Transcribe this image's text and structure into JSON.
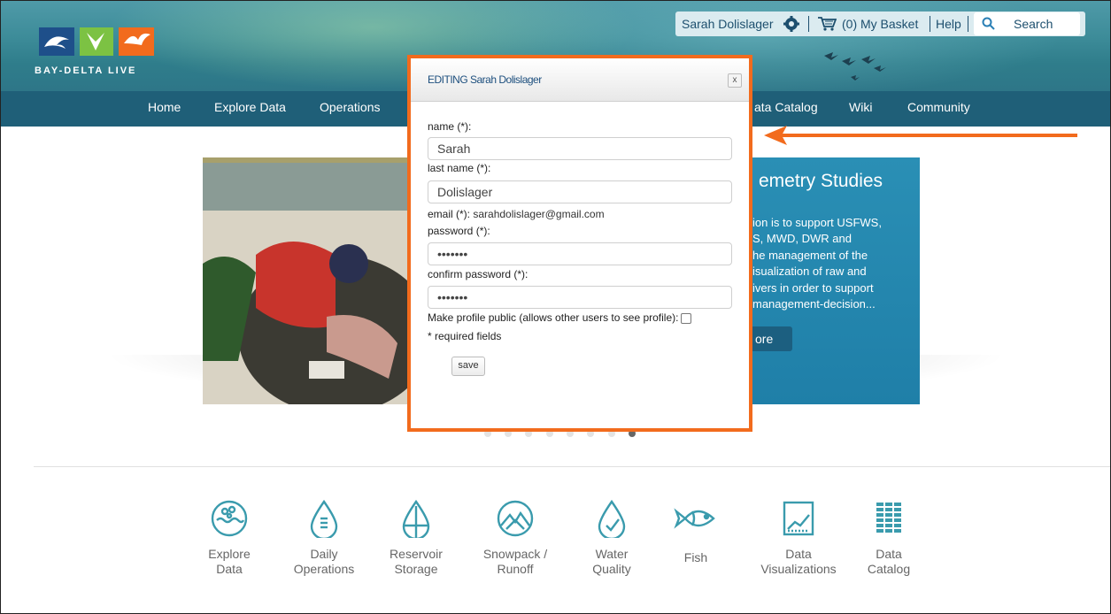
{
  "brand": {
    "logo_text": "BAY-DELTA LIVE"
  },
  "util_bar": {
    "user": "Sarah Dolislager",
    "basket": "(0) My Basket",
    "help": "Help",
    "search_placeholder": "Search"
  },
  "nav": [
    "Home",
    "Explore Data",
    "Operations",
    "ata Catalog",
    "Wiki",
    "Community"
  ],
  "slide": {
    "title": "emetry Studies",
    "lines": [
      "ion is to support USFWS,",
      "S, MWD, DWR and",
      "he management of the",
      "isualization of raw and",
      "ivers in order to support",
      "management-decision..."
    ],
    "more_label": "ore",
    "dot_count": 8,
    "active_dot": 8
  },
  "modal": {
    "title": "EDITING Sarah Dolislager",
    "close": "x",
    "name_label": "name (*):",
    "name_value": "Sarah",
    "last_label": "last name (*):",
    "last_value": "Dolislager",
    "email_label": "email (*):",
    "email_value": "sarahdolislager@gmail.com",
    "password_label": "password (*):",
    "password_value": "•••••••",
    "confirm_label": "confirm password (*):",
    "confirm_value": "•••••••",
    "public_label": "Make profile public (allows other users to see profile):",
    "required_note": "* required fields",
    "save_label": "save"
  },
  "features": [
    {
      "icon": "explore-data-icon",
      "line1": "Explore",
      "line2": "Data"
    },
    {
      "icon": "daily-operations-icon",
      "line1": "Daily",
      "line2": "Operations"
    },
    {
      "icon": "reservoir-storage-icon",
      "line1": "Reservoir",
      "line2": "Storage"
    },
    {
      "icon": "snowpack-runoff-icon",
      "line1": "Snowpack /",
      "line2": "Runoff"
    },
    {
      "icon": "water-quality-icon",
      "line1": "Water",
      "line2": "Quality"
    },
    {
      "icon": "fish-icon",
      "line1": "Fish",
      "line2": ""
    },
    {
      "icon": "data-visualizations-icon",
      "line1": "Data",
      "line2": "Visualizations"
    },
    {
      "icon": "data-catalog-icon",
      "line1": "Data",
      "line2": "Catalog"
    }
  ],
  "colors": {
    "accent": "#f26b1d",
    "teal": "#3a9bad",
    "nav": "#1f5f78",
    "slide_panel": "#2a8fb5"
  }
}
